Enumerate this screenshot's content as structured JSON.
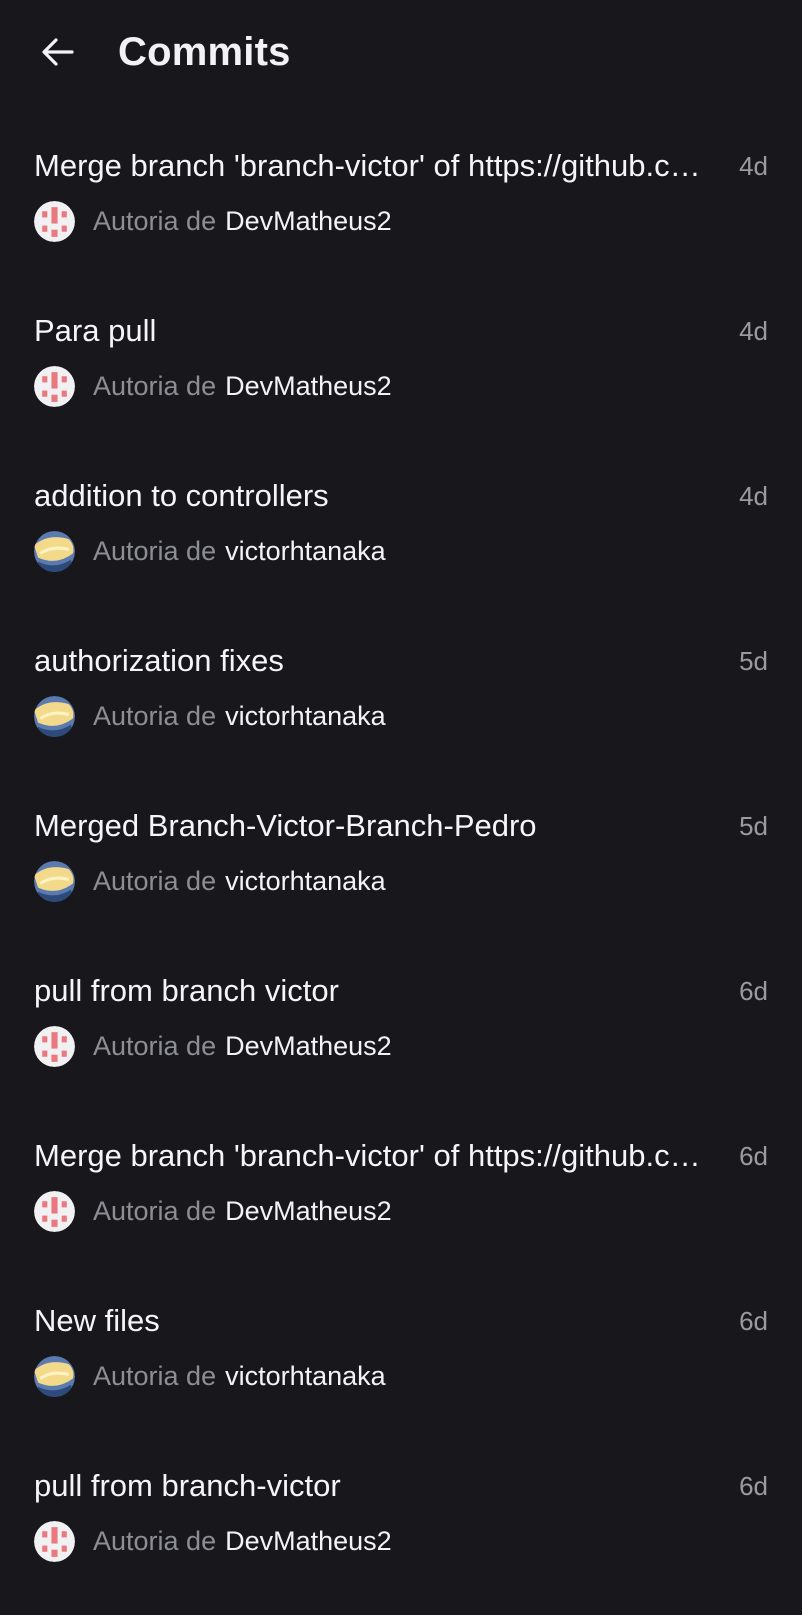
{
  "header": {
    "title": "Commits",
    "back_icon": "arrow-left-icon"
  },
  "colors": {
    "background": "#18181c",
    "text_primary": "#f3f3f5",
    "text_secondary": "#8d8d95",
    "avatar_devmatheus": "#e9787f",
    "avatar_victor": "#f3d98a"
  },
  "author_prefix": "Autoria de",
  "commits": [
    {
      "title": "Merge branch 'branch-victor' of https://github.com/...",
      "age": "4d",
      "author": "DevMatheus2",
      "avatar": "identicon-avatar"
    },
    {
      "title": "Para pull",
      "age": "4d",
      "author": "DevMatheus2",
      "avatar": "identicon-avatar"
    },
    {
      "title": "addition to controllers",
      "age": "4d",
      "author": "victorhtanaka",
      "avatar": "photo-avatar"
    },
    {
      "title": "authorization fixes",
      "age": "5d",
      "author": "victorhtanaka",
      "avatar": "photo-avatar"
    },
    {
      "title": "Merged Branch-Victor-Branch-Pedro",
      "age": "5d",
      "author": "victorhtanaka",
      "avatar": "photo-avatar"
    },
    {
      "title": "pull from branch victor",
      "age": "6d",
      "author": "DevMatheus2",
      "avatar": "identicon-avatar"
    },
    {
      "title": "Merge branch 'branch-victor' of https://github.com/...",
      "age": "6d",
      "author": "DevMatheus2",
      "avatar": "identicon-avatar"
    },
    {
      "title": "New files",
      "age": "6d",
      "author": "victorhtanaka",
      "avatar": "photo-avatar"
    },
    {
      "title": "pull from branch-victor",
      "age": "6d",
      "author": "DevMatheus2",
      "avatar": "identicon-avatar"
    }
  ]
}
